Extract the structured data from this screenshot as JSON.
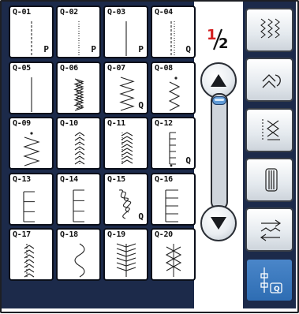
{
  "tiles": [
    {
      "code": "Q-01",
      "mark": "P"
    },
    {
      "code": "Q-02",
      "mark": "P"
    },
    {
      "code": "Q-03",
      "mark": "P"
    },
    {
      "code": "Q-04",
      "mark": "Q"
    },
    {
      "code": "Q-05",
      "mark": ""
    },
    {
      "code": "Q-06",
      "mark": ""
    },
    {
      "code": "Q-07",
      "mark": "Q"
    },
    {
      "code": "Q-08",
      "mark": ""
    },
    {
      "code": "Q-09",
      "mark": ""
    },
    {
      "code": "Q-10",
      "mark": ""
    },
    {
      "code": "Q-11",
      "mark": ""
    },
    {
      "code": "Q-12",
      "mark": "Q"
    },
    {
      "code": "Q-13",
      "mark": ""
    },
    {
      "code": "Q-14",
      "mark": ""
    },
    {
      "code": "Q-15",
      "mark": "Q"
    },
    {
      "code": "Q-16",
      "mark": ""
    },
    {
      "code": "Q-17",
      "mark": ""
    },
    {
      "code": "Q-18",
      "mark": ""
    },
    {
      "code": "Q-19",
      "mark": ""
    },
    {
      "code": "Q-20",
      "mark": ""
    }
  ],
  "pager": {
    "current": "1",
    "total": "2",
    "current_color": "#d42020"
  },
  "scroll": {
    "up_icon": "triangle-up-icon",
    "down_icon": "triangle-down-icon",
    "position_fraction": 0
  },
  "side_menu": [
    {
      "icon": "utility-stitch-icon",
      "active": false
    },
    {
      "icon": "decorative-stitch-icon",
      "active": false
    },
    {
      "icon": "cross-stitch-icon",
      "active": false
    },
    {
      "icon": "buttonhole-icon",
      "active": false
    },
    {
      "icon": "satin-stitch-icon",
      "active": false
    },
    {
      "icon": "quilting-stitch-icon",
      "active": true,
      "badge": "Q"
    }
  ],
  "colors": {
    "panel": "#1c2a4a",
    "active": "#2e6db3",
    "accent_red": "#d42020"
  }
}
